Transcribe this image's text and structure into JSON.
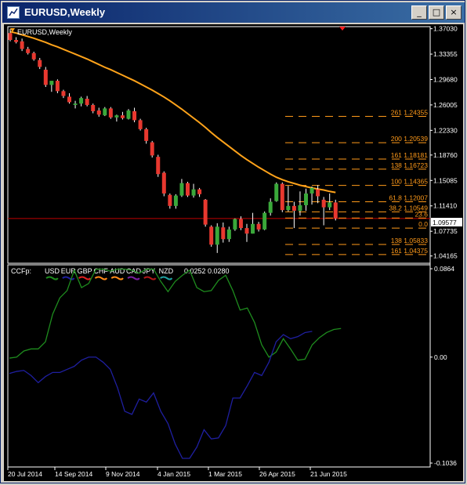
{
  "window": {
    "title": "EURUSD,Weekly",
    "icon": "chart-window-icon",
    "minimize_glyph": "_",
    "maximize_glyph": "□",
    "close_glyph": "×"
  },
  "colors": {
    "background": "#000000",
    "grid": "#ffffff",
    "bull_candle": "#3aa83a",
    "bear_candle": "#e8382f",
    "moving_average": "#ffa31a",
    "fibonacci": "#ff9a1a",
    "bid_line": "#c00000",
    "ccfp_eur": "#1f1fa0",
    "ccfp_usd": "#1e8c1e"
  },
  "price_chart": {
    "label": "EURUSD,Weekly",
    "current_price": "1.09577",
    "price_scale": [
      "1.37030",
      "1.33355",
      "1.29680",
      "1.26005",
      "1.22330",
      "1.18760",
      "1.15085",
      "1.11410",
      "1.07735",
      "1.04165"
    ],
    "fib_levels": [
      {
        "label": "261  1.24355",
        "value": 1.24355
      },
      {
        "label": "200  1.20539",
        "value": 1.20539
      },
      {
        "label": "161  1.18181",
        "value": 1.18181
      },
      {
        "label": "138  1.16723",
        "value": 1.16723
      },
      {
        "label": "100  1.14365",
        "value": 1.14365
      },
      {
        "label": "61.8  1.12007",
        "value": 1.12007
      },
      {
        "label": "38.2  1.10549",
        "value": 1.10549
      },
      {
        "label": "23.6",
        "value": 1.0965
      },
      {
        "label": "0.0",
        "value": 1.0819
      },
      {
        "label": "138  1.05833",
        "value": 1.05833
      },
      {
        "label": "161  1.04375",
        "value": 1.04375
      }
    ]
  },
  "ccfp": {
    "header": "CCFp:",
    "currencies": [
      {
        "name": "USD",
        "color": "#1e8c1e"
      },
      {
        "name": "EUR",
        "color": "#1f1fa0"
      },
      {
        "name": "GBP",
        "color": "#e02020"
      },
      {
        "name": "CHF",
        "color": "#ff8a1a"
      },
      {
        "name": "AUD",
        "color": "#ff8a1a"
      },
      {
        "name": "CAD",
        "color": "#7a1fa0"
      },
      {
        "name": "JPY",
        "color": "#b01818"
      },
      {
        "name": "NZD",
        "color": "#1fa0a0"
      }
    ],
    "values_text": "0.0252  0.0280",
    "scale": [
      "0.0864",
      "0.00",
      "-0.1036"
    ]
  },
  "time_axis": [
    "20 Jul 2014",
    "14 Sep 2014",
    "9 Nov 2014",
    "4 Jan 2015",
    "1 Mar 2015",
    "26 Apr 2015",
    "21 Jun 2015"
  ],
  "chart_data": [
    {
      "type": "candlestick",
      "title": "EURUSD,Weekly",
      "ylim": [
        1.0345,
        1.371
      ],
      "candles": [
        [
          1.364,
          1.37,
          1.352,
          1.354
        ],
        [
          1.354,
          1.358,
          1.349,
          1.351
        ],
        [
          1.352,
          1.356,
          1.338,
          1.341
        ],
        [
          1.341,
          1.344,
          1.333,
          1.335
        ],
        [
          1.335,
          1.337,
          1.324,
          1.326
        ],
        [
          1.325,
          1.328,
          1.312,
          1.315
        ],
        [
          1.311,
          1.315,
          1.286,
          1.289
        ],
        [
          1.289,
          1.293,
          1.279,
          1.295
        ],
        [
          1.295,
          1.297,
          1.277,
          1.28
        ],
        [
          1.28,
          1.282,
          1.27,
          1.273
        ],
        [
          1.272,
          1.277,
          1.262,
          1.264
        ],
        [
          1.26,
          1.266,
          1.255,
          1.262
        ],
        [
          1.262,
          1.272,
          1.258,
          1.27
        ],
        [
          1.269,
          1.273,
          1.258,
          1.26
        ],
        [
          1.26,
          1.262,
          1.248,
          1.251
        ],
        [
          1.252,
          1.256,
          1.243,
          1.246
        ],
        [
          1.245,
          1.257,
          1.244,
          1.255
        ],
        [
          1.255,
          1.257,
          1.24,
          1.242
        ],
        [
          1.242,
          1.246,
          1.236,
          1.245
        ],
        [
          1.245,
          1.25,
          1.239,
          1.241
        ],
        [
          1.24,
          1.254,
          1.239,
          1.252
        ],
        [
          1.251,
          1.256,
          1.235,
          1.238
        ],
        [
          1.238,
          1.24,
          1.223,
          1.225
        ],
        [
          1.225,
          1.227,
          1.204,
          1.208
        ],
        [
          1.206,
          1.208,
          1.184,
          1.187
        ],
        [
          1.185,
          1.188,
          1.156,
          1.16
        ],
        [
          1.162,
          1.164,
          1.128,
          1.132
        ],
        [
          1.13,
          1.132,
          1.11,
          1.114
        ],
        [
          1.114,
          1.131,
          1.11,
          1.129
        ],
        [
          1.129,
          1.153,
          1.127,
          1.147
        ],
        [
          1.147,
          1.149,
          1.127,
          1.129
        ],
        [
          1.129,
          1.146,
          1.126,
          1.138
        ],
        [
          1.138,
          1.14,
          1.127,
          1.131
        ],
        [
          1.123,
          1.124,
          1.084,
          1.087
        ],
        [
          1.084,
          1.086,
          1.055,
          1.058
        ],
        [
          1.058,
          1.089,
          1.046,
          1.084
        ],
        [
          1.083,
          1.09,
          1.061,
          1.066
        ],
        [
          1.066,
          1.084,
          1.062,
          1.08
        ],
        [
          1.08,
          1.096,
          1.078,
          1.095
        ],
        [
          1.095,
          1.099,
          1.079,
          1.082
        ],
        [
          1.082,
          1.088,
          1.062,
          1.074
        ],
        [
          1.074,
          1.104,
          1.074,
          1.088
        ],
        [
          1.088,
          1.091,
          1.077,
          1.08
        ],
        [
          1.08,
          1.106,
          1.079,
          1.104
        ],
        [
          1.104,
          1.125,
          1.1,
          1.12
        ],
        [
          1.121,
          1.148,
          1.12,
          1.146
        ],
        [
          1.146,
          1.148,
          1.105,
          1.108
        ],
        [
          1.108,
          1.143,
          1.106,
          1.114
        ],
        [
          1.114,
          1.12,
          1.082,
          1.107
        ],
        [
          1.107,
          1.135,
          1.1,
          1.115
        ],
        [
          1.115,
          1.139,
          1.107,
          1.132
        ],
        [
          1.132,
          1.142,
          1.116,
          1.14
        ],
        [
          1.138,
          1.144,
          1.118,
          1.128
        ],
        [
          1.123,
          1.127,
          1.086,
          1.112
        ],
        [
          1.112,
          1.132,
          1.108,
          1.119
        ],
        [
          1.119,
          1.123,
          1.093,
          1.096
        ]
      ],
      "moving_average": [
        1.366,
        1.364,
        1.3615,
        1.359,
        1.3565,
        1.3535,
        1.3505,
        1.347,
        1.344,
        1.3405,
        1.337,
        1.3335,
        1.33,
        1.3265,
        1.3225,
        1.3185,
        1.3145,
        1.311,
        1.307,
        1.303,
        1.299,
        1.295,
        1.2905,
        1.286,
        1.2815,
        1.2765,
        1.2715,
        1.266,
        1.26,
        1.254,
        1.2475,
        1.241,
        1.2345,
        1.2275,
        1.22,
        1.213,
        1.2065,
        1.2,
        1.1935,
        1.187,
        1.181,
        1.1755,
        1.17,
        1.165,
        1.16,
        1.1555,
        1.152,
        1.149,
        1.1465,
        1.144,
        1.142,
        1.14,
        1.1385,
        1.137,
        1.135,
        1.1335
      ]
    },
    {
      "type": "line",
      "title": "CCFp",
      "ylim": [
        -0.1036,
        0.0864
      ],
      "series": [
        {
          "name": "USD",
          "values": [
            -0.001,
            0.0,
            0.006,
            0.008,
            0.008,
            0.015,
            0.042,
            0.058,
            0.065,
            0.085,
            0.068,
            0.072,
            0.086,
            0.086,
            0.084,
            0.086,
            0.086,
            0.085,
            0.082,
            0.086,
            0.086,
            0.074,
            0.064,
            0.074,
            0.08,
            0.085,
            0.068,
            0.064,
            0.065,
            0.075,
            0.08,
            0.065,
            0.046,
            0.048,
            0.034,
            0.012,
            0.0,
            0.005,
            0.018,
            0.008,
            -0.003,
            -0.002,
            0.012,
            0.019,
            0.024,
            0.027,
            0.028
          ]
        },
        {
          "name": "EUR",
          "values": [
            -0.016,
            -0.014,
            -0.013,
            -0.018,
            -0.025,
            -0.019,
            -0.015,
            -0.015,
            -0.012,
            -0.009,
            -0.003,
            0.0,
            0.0,
            -0.005,
            -0.012,
            -0.03,
            -0.053,
            -0.056,
            -0.041,
            -0.044,
            -0.035,
            -0.053,
            -0.065,
            -0.085,
            -0.099,
            -0.099,
            -0.088,
            -0.071,
            -0.08,
            -0.079,
            -0.067,
            -0.04,
            -0.04,
            -0.028,
            -0.015,
            -0.018,
            -0.005,
            0.015,
            0.022,
            0.018,
            0.02,
            0.024,
            0.0252
          ]
        }
      ],
      "xlabel": "",
      "ylabel": ""
    }
  ]
}
